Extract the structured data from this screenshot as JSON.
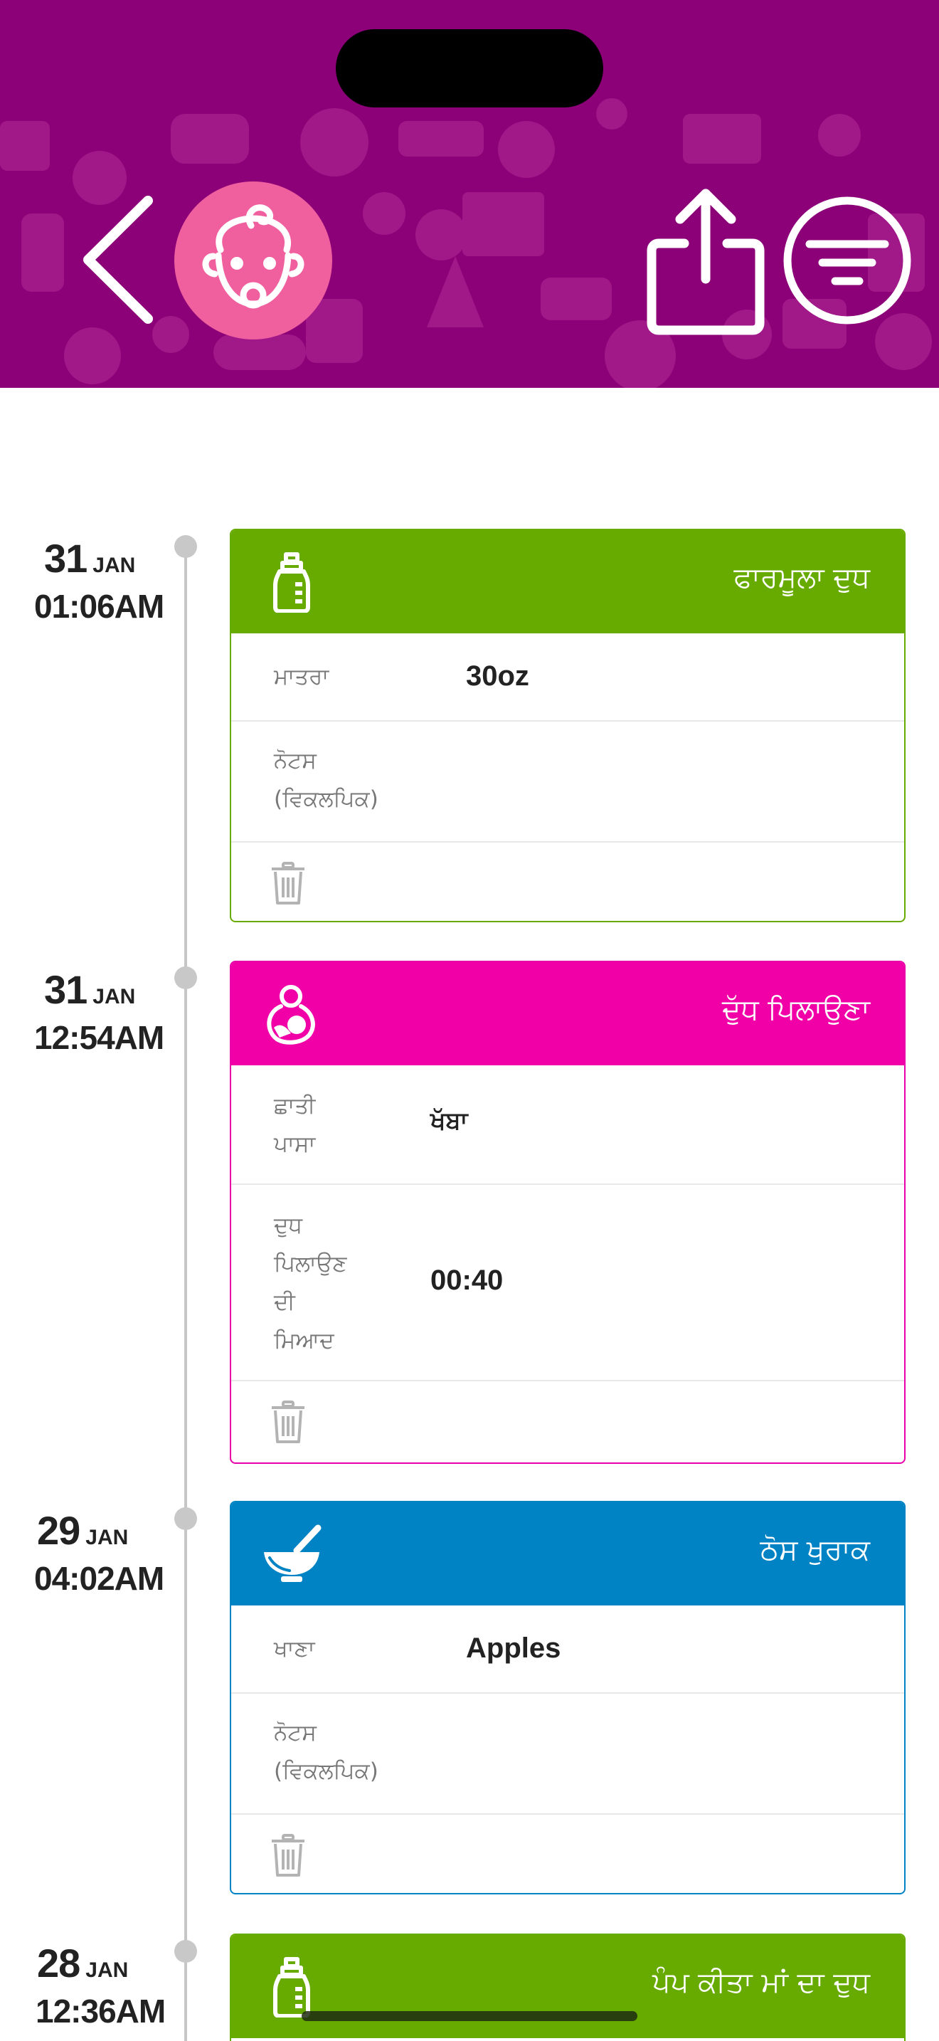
{
  "colors": {
    "header_bg": "#8c0078",
    "avatar_bg": "#f0609e",
    "formula_green": "#67ab00",
    "breastfeed_pink": "#f200a7",
    "solids_blue": "#0083c4",
    "timeline_gray": "#c6c6c6"
  },
  "header": {
    "back_icon": "chevron-left-icon",
    "avatar_icon": "baby-face-icon",
    "share_icon": "share-icon",
    "filter_icon": "filter-icon"
  },
  "entries": [
    {
      "day": "31",
      "month": "JAN",
      "time": "01:06AM",
      "type_icon": "bottle-icon",
      "title": "ਫਾਰਮੂਲਾ ਦੁਧ",
      "rows": [
        {
          "label_lines": [
            "ਮਾਤਰਾ"
          ],
          "value": "30oz"
        },
        {
          "label_lines": [
            "ਨੋਟਸ",
            "(ਵਿਕਲਪਿਕ)"
          ],
          "value": ""
        }
      ]
    },
    {
      "day": "31",
      "month": "JAN",
      "time": "12:54AM",
      "type_icon": "breastfeeding-icon",
      "title": "ਦੁੱਧ ਪਿਲਾਉਣਾ",
      "rows": [
        {
          "label_lines": [
            "ਛਾਤੀ",
            "ਪਾਸਾ"
          ],
          "value": "ਖੱਬਾ"
        },
        {
          "label_lines": [
            "ਦੁਧ",
            "ਪਿਲਾਉਣ",
            "ਦੀ",
            "ਮਿਆਦ"
          ],
          "value": "00:40"
        }
      ]
    },
    {
      "day": "29",
      "month": "JAN",
      "time": "04:02AM",
      "type_icon": "mortar-bowl-icon",
      "title": "ਠੋਸ ਖੁਰਾਕ",
      "rows": [
        {
          "label_lines": [
            "ਖਾਣਾ"
          ],
          "value": "Apples"
        },
        {
          "label_lines": [
            "ਨੋਟਸ",
            "(ਵਿਕਲਪਿਕ)"
          ],
          "value": ""
        }
      ]
    },
    {
      "day": "28",
      "month": "JAN",
      "time": "12:36AM",
      "type_icon": "bottle-icon",
      "title": "ਪੰਪ ਕੀਤਾ ਮਾਂ ਦਾ ਦੁਧ"
    }
  ]
}
